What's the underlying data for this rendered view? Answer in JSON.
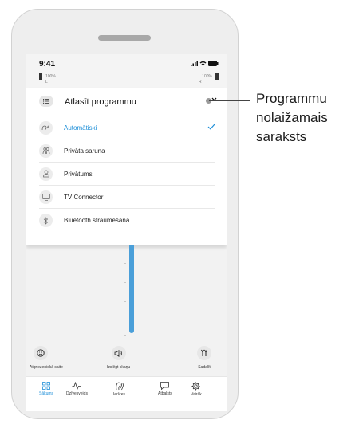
{
  "status": {
    "time": "9:41",
    "battery_left": "100%",
    "battery_right": "100%",
    "left_label": "L",
    "right_label": "R"
  },
  "dropdown": {
    "title": "Atlasīt programmu",
    "items": [
      {
        "label": "Automātiski",
        "icon": "auto-program-icon",
        "selected": true
      },
      {
        "label": "Privāta saruna",
        "icon": "conversation-icon",
        "selected": false
      },
      {
        "label": "Privātums",
        "icon": "privacy-icon",
        "selected": false
      },
      {
        "label": "TV Connector",
        "icon": "tv-icon",
        "selected": false
      },
      {
        "label": "Bluetooth straumēšana",
        "icon": "bluetooth-icon",
        "selected": false
      }
    ]
  },
  "actions": {
    "feedback": "Atgriezeniskā saite",
    "mute": "Izslēgt skaņu",
    "split": "Sadalīt"
  },
  "tabs": {
    "home": "Sākums",
    "lifestyle": "Dzīvesveids",
    "devices": "Ierīces",
    "support": "Atbalsts",
    "more": "Vairāk"
  },
  "callout": {
    "line1": "Programmu",
    "line2": "nolaižamais",
    "line3": "saraksts"
  },
  "colors": {
    "accent": "#1e8fd8",
    "volume": "#4a9fd9"
  }
}
